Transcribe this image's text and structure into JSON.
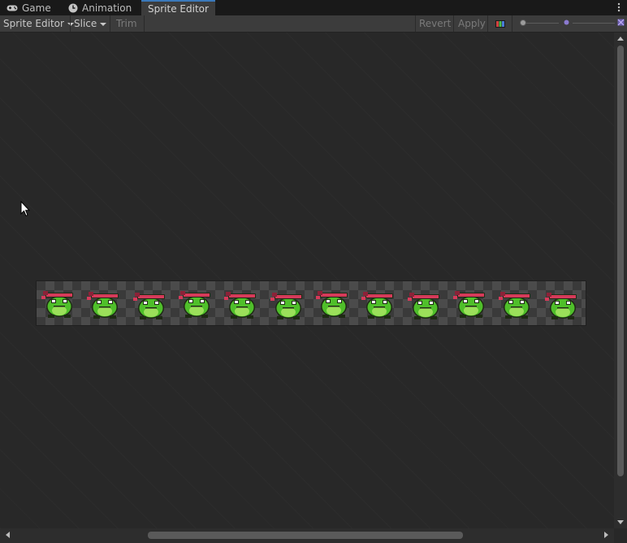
{
  "tabs": [
    {
      "label": "Game",
      "icon": "gamepad-icon",
      "active": false
    },
    {
      "label": "Animation",
      "icon": "clock-icon",
      "active": false
    },
    {
      "label": "Sprite Editor",
      "icon": "",
      "active": true
    }
  ],
  "toolbar": {
    "mode_dropdown": "Sprite Editor",
    "slice_dropdown": "Slice",
    "trim_label": "Trim",
    "revert_label": "Revert",
    "apply_label": "Apply",
    "channels_icon": "rgb-channels-icon"
  },
  "canvas": {
    "sprite_frame_count": 12,
    "sprite_colors": {
      "body": "#4fbf2a",
      "belly": "#9be05a",
      "outline": "#1e2a14",
      "headband": "#d63a5a",
      "headband_dark": "#8c2238",
      "eye": "#ffffff"
    },
    "checker_colors": [
      "#3a3a3a",
      "#4b4b4b"
    ]
  },
  "colors": {
    "background": "#282828",
    "toolbar": "#3c3c3c",
    "tabbar": "#191919",
    "active_tab_accent": "#3a79bb"
  }
}
